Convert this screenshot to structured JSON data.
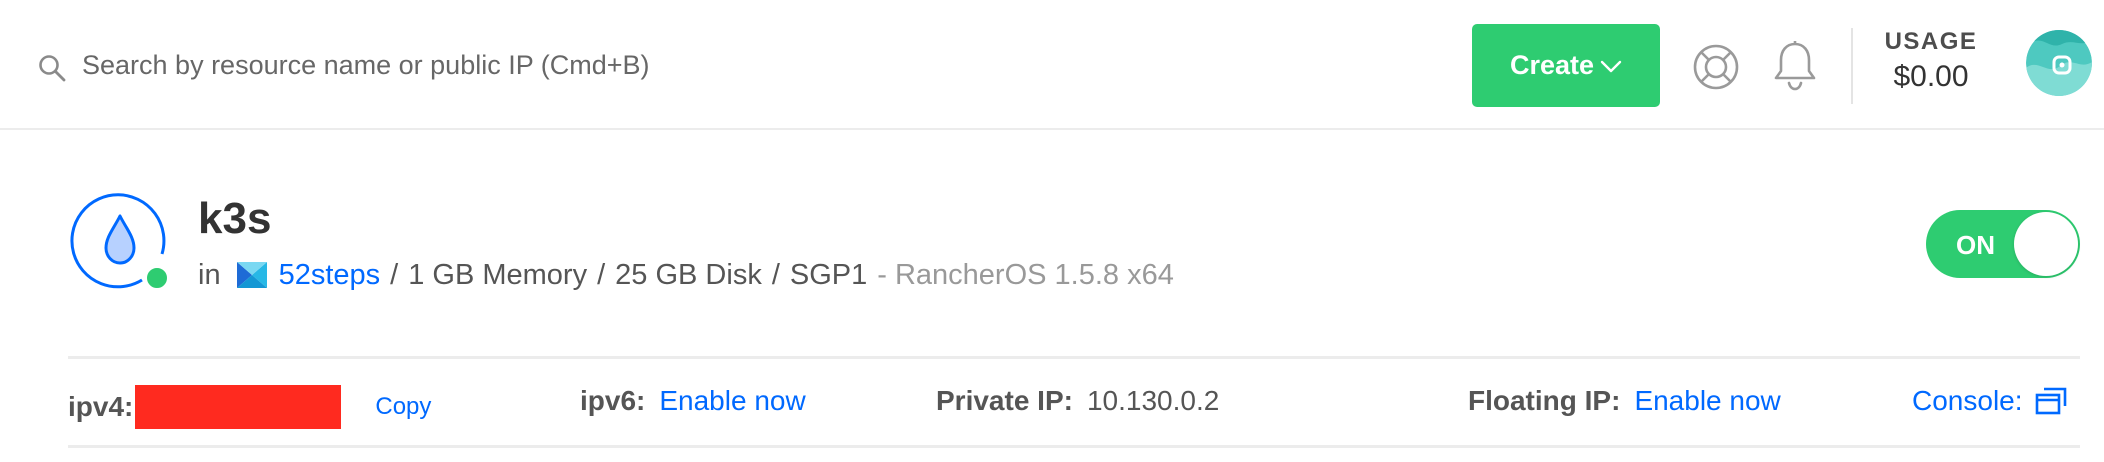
{
  "header": {
    "search": {
      "placeholder": "Search by resource name or public IP (Cmd+B)",
      "value": ""
    },
    "create_label": "Create",
    "usage": {
      "label": "USAGE",
      "value": "$0.00"
    }
  },
  "droplet": {
    "name": "k3s",
    "in_label": "in",
    "project": "52steps",
    "memory": "1 GB Memory",
    "disk": "25 GB Disk",
    "region": "SGP1",
    "os": "- RancherOS 1.5.8 x64",
    "power": "ON",
    "status": "active"
  },
  "network": {
    "ipv4_label": "ipv4:",
    "copy_label": "Copy",
    "ipv6_label": "ipv6:",
    "ipv6_action": "Enable now",
    "private_ip_label": "Private IP:",
    "private_ip": "10.130.0.2",
    "floating_ip_label": "Floating IP:",
    "floating_ip_action": "Enable now",
    "console_label": "Console:"
  },
  "colors": {
    "accent": "#0069ff",
    "success": "#2ecc71",
    "redaction": "#ff2a1f"
  }
}
